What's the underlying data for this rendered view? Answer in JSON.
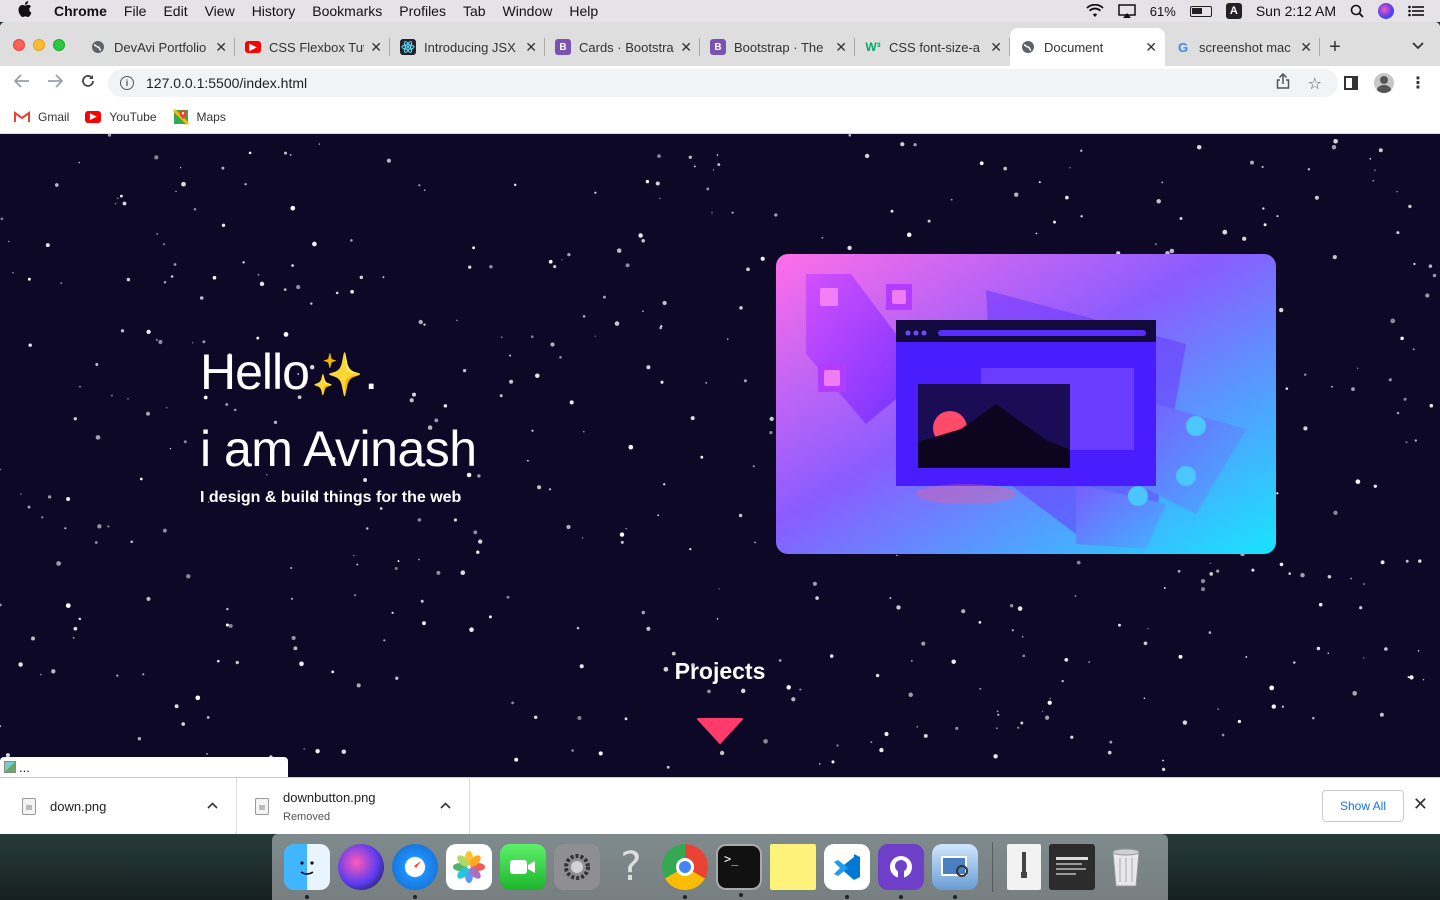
{
  "menubar": {
    "app": "Chrome",
    "items": [
      "File",
      "Edit",
      "View",
      "History",
      "Bookmarks",
      "Profiles",
      "Tab",
      "Window",
      "Help"
    ],
    "battery": "61%",
    "input_source": "A",
    "clock": "Sun 2:12 AM"
  },
  "tabs": [
    {
      "title": "DevAvi Portfolio",
      "icon": "globe-icon",
      "color": "#555555"
    },
    {
      "title": "CSS Flexbox Tut",
      "icon": "youtube-icon",
      "color": "#ff0000"
    },
    {
      "title": "Introducing JSX",
      "icon": "react-icon",
      "color": "#20232a"
    },
    {
      "title": "Cards · Bootstra",
      "icon": "bootstrap-icon",
      "color": "#7952b3"
    },
    {
      "title": "Bootstrap · The",
      "icon": "bootstrap-icon",
      "color": "#7952b3"
    },
    {
      "title": "CSS font-size-a",
      "icon": "w3schools-icon",
      "color": "#04aa6d"
    },
    {
      "title": "Document",
      "icon": "globe-icon",
      "color": "#555555",
      "active": true
    },
    {
      "title": "screenshot mac",
      "icon": "google-icon",
      "color": "#4285f4"
    }
  ],
  "toolbar": {
    "url": "127.0.0.1:5500/index.html"
  },
  "bookmarks": [
    {
      "label": "Gmail",
      "icon": "gmail-icon"
    },
    {
      "label": "YouTube",
      "icon": "youtube-icon"
    },
    {
      "label": "Maps",
      "icon": "maps-icon"
    }
  ],
  "page": {
    "hello": "Hello",
    "sparkle": "✨",
    "period": ".",
    "name": "i am Avinash",
    "tagline": "I design & build things for the web",
    "projects": "Projects",
    "broken_image": "...",
    "accent": "#ff3b6b",
    "background": "#0c0826"
  },
  "downloads": {
    "items": [
      {
        "name": "down.png",
        "status": ""
      },
      {
        "name": "downbutton.png",
        "status": "Removed"
      }
    ],
    "show_all": "Show All"
  },
  "dock": {
    "apps": [
      "finder-icon",
      "siri-icon",
      "safari-icon",
      "photos-icon",
      "facetime-icon",
      "system-preferences-icon",
      "help-icon",
      "chrome-icon",
      "terminal-icon",
      "stickies-icon",
      "vscode-icon",
      "github-desktop-icon",
      "preview-icon",
      "archive-icon",
      "screenshot-icon",
      "trash-icon"
    ]
  }
}
